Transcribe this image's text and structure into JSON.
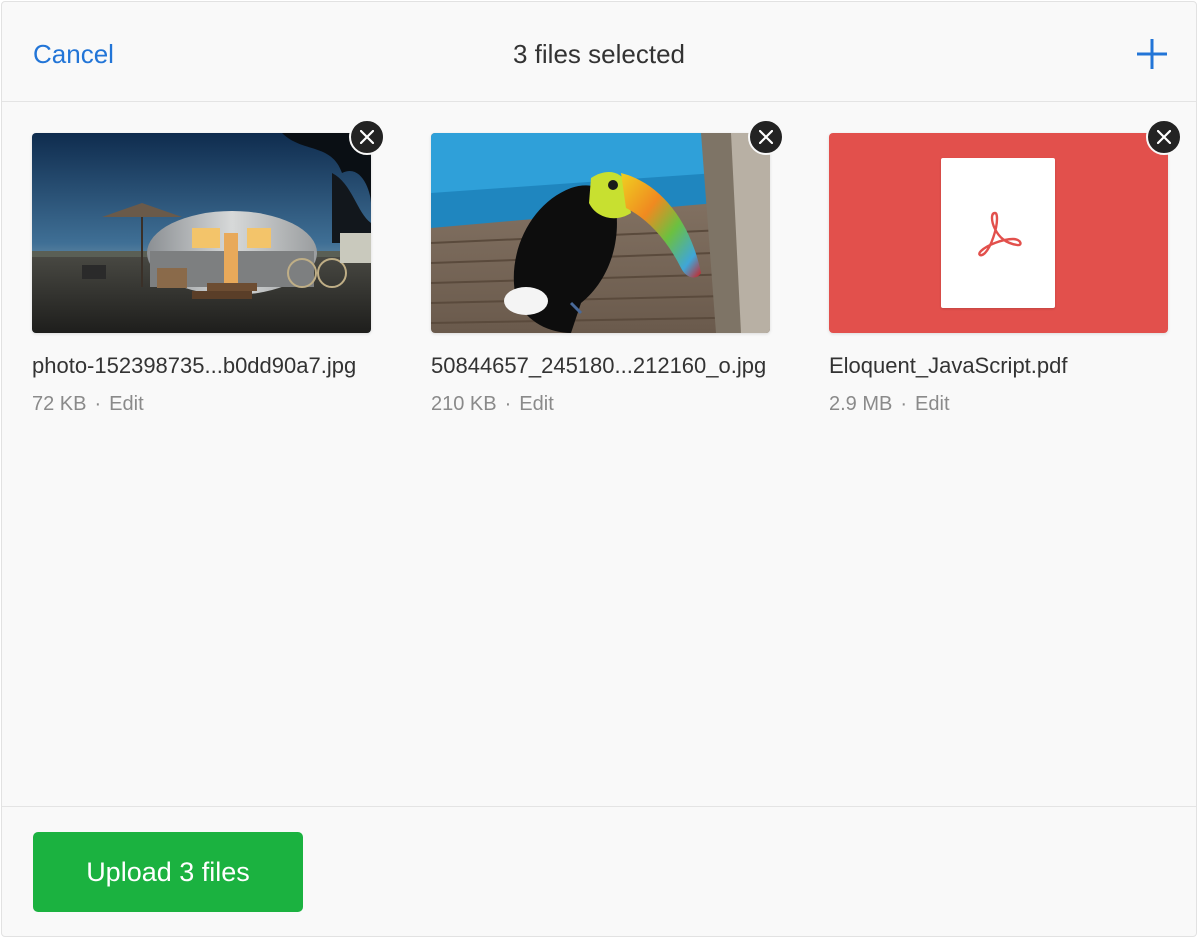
{
  "header": {
    "cancel_label": "Cancel",
    "title": "3 files selected",
    "add_icon": "plus-icon"
  },
  "files": [
    {
      "name": "photo-152398735...b0dd90a7.jpg",
      "size": "72 KB",
      "edit_label": "Edit",
      "kind": "image",
      "preview": "camper-trailer-photo"
    },
    {
      "name": "50844657_245180...212160_o.jpg",
      "size": "210 KB",
      "edit_label": "Edit",
      "kind": "image",
      "preview": "toucan-photo"
    },
    {
      "name": "Eloquent_JavaScript.pdf",
      "size": "2.9 MB",
      "edit_label": "Edit",
      "kind": "pdf",
      "preview": "pdf-icon"
    }
  ],
  "meta_separator": "·",
  "footer": {
    "upload_label": "Upload 3 files"
  },
  "colors": {
    "accent": "#2275d7",
    "upload_button": "#1bb240",
    "pdf_tile": "#e2504c",
    "remove_button": "#232323"
  }
}
